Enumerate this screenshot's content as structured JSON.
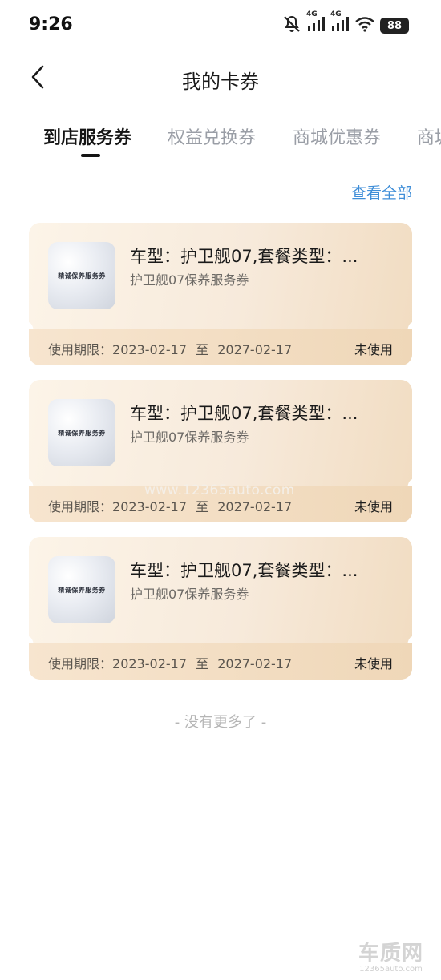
{
  "status_bar": {
    "time": "9:26",
    "network_label_1": "4G",
    "network_label_2": "4G",
    "battery": "88",
    "icons": [
      "mute-bell-icon",
      "signal-4g-icon",
      "signal-4g-icon",
      "wifi-icon",
      "battery-icon"
    ]
  },
  "header": {
    "back_icon": "chevron-left-icon",
    "title": "我的卡券"
  },
  "tabs": [
    {
      "label": "到店服务券",
      "active": true
    },
    {
      "label": "权益兑换券",
      "active": false
    },
    {
      "label": "商城优惠券",
      "active": false
    },
    {
      "label": "商城",
      "active": false
    }
  ],
  "view_all": "查看全部",
  "coupons": [
    {
      "thumb_label": "精诚保养服务券",
      "title": "车型：护卫舰07,套餐类型：...",
      "subtitle": "护卫舰07保养服务券",
      "validity_label": "使用期限：",
      "start_date": "2023-02-17",
      "to": "至",
      "end_date": "2027-02-17",
      "status": "未使用"
    },
    {
      "thumb_label": "精诚保养服务券",
      "title": "车型：护卫舰07,套餐类型：...",
      "subtitle": "护卫舰07保养服务券",
      "validity_label": "使用期限：",
      "start_date": "2023-02-17",
      "to": "至",
      "end_date": "2027-02-17",
      "status": "未使用"
    },
    {
      "thumb_label": "精诚保养服务券",
      "title": "车型：护卫舰07,套餐类型：...",
      "subtitle": "护卫舰07保养服务券",
      "validity_label": "使用期限：",
      "start_date": "2023-02-17",
      "to": "至",
      "end_date": "2027-02-17",
      "status": "未使用"
    }
  ],
  "no_more": "- 没有更多了 -",
  "watermark": {
    "center_text": "www.12365auto.com",
    "logo": "车质网",
    "url": "12365auto.com"
  },
  "colors": {
    "accent_link": "#3f8ed8",
    "card_bg": "#f7eadb",
    "active_tab": "#141414",
    "inactive_tab": "#9a9ea6"
  }
}
